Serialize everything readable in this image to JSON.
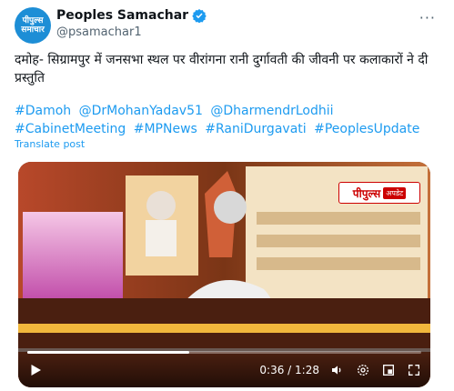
{
  "account": {
    "avatar_lines": [
      "पीपुल्स",
      "समाचार"
    ],
    "display_name": "Peoples Samachar",
    "handle": "@psamachar1",
    "verified": true
  },
  "tweet": {
    "text": "दमोह- सिग्रामपुर में जनसभा स्थल पर वीरांगना रानी दुर्गावती की जीवनी पर कलाकारों ने दी प्रस्तुति",
    "hashtags": [
      "#Damoh",
      "@DrMohanYadav51",
      "@DharmendrLodhii",
      "#CabinetMeeting",
      "#MPNews",
      "#RaniDurgavati",
      "#PeoplesUpdate"
    ],
    "translate_label": "Translate post"
  },
  "video": {
    "watermark_brand": "पीपुल्स",
    "watermark_sub": "अपडेट",
    "time_label": "0:36 / 1:28",
    "progress_fraction": 0.41
  },
  "colors": {
    "link": "#1d9bf0",
    "verified": "#1d9bf0",
    "brand": "#1d8ed6"
  }
}
